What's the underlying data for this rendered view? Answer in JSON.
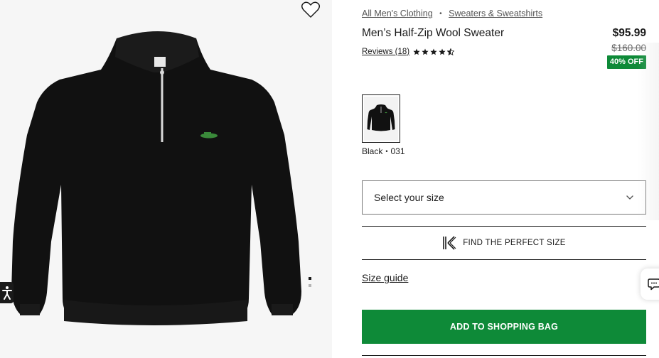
{
  "breadcrumb": {
    "items": [
      {
        "label": "All Men's Clothing"
      },
      {
        "label": "Sweaters & Sweatshirts"
      }
    ],
    "separator": "•"
  },
  "product": {
    "title": "Men’s Half-Zip Wool Sweater",
    "price_current": "$95.99",
    "price_original": "$160.00",
    "discount_badge": "40% OFF",
    "reviews_label": "Reviews (18)",
    "rating": 4.5,
    "rating_max": 5
  },
  "color": {
    "name": "Black",
    "separator": "•",
    "code": "031"
  },
  "size_select": {
    "placeholder": "Select your size"
  },
  "fit_finder": {
    "label": "FIND THE PERFECT SIZE"
  },
  "size_guide": {
    "label": "Size guide"
  },
  "cart": {
    "add_label": "ADD TO SHOPPING BAG"
  },
  "colors": {
    "brand_green": "#0e8a38",
    "text_dark": "#1a1a1a",
    "gallery_bg": "#f6f6f6"
  },
  "icons": [
    "heart-icon",
    "accessibility-icon",
    "star-icon",
    "chevron-down-icon",
    "fit-finder-k-icon",
    "chat-icon"
  ]
}
